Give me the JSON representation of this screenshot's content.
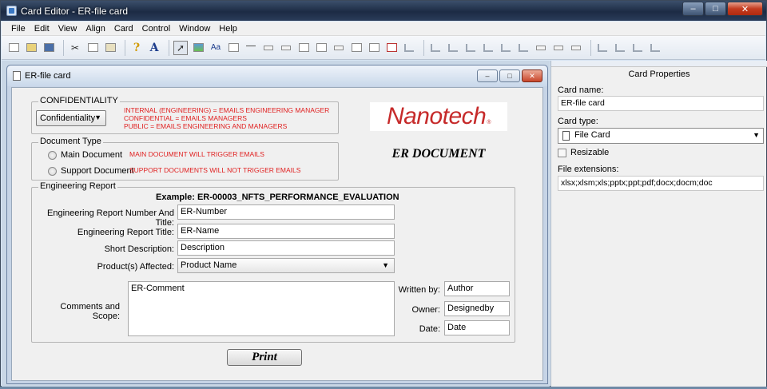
{
  "window": {
    "title": "Card Editor - ER-file card",
    "min_label": "–",
    "max_label": "□",
    "close_label": "✕"
  },
  "menu": [
    "File",
    "Edit",
    "View",
    "Align",
    "Card",
    "Control",
    "Window",
    "Help"
  ],
  "toolbar": {
    "icons": [
      "new-icon",
      "open-icon",
      "save-icon",
      "cut-icon",
      "copy-icon",
      "paste-icon",
      "help-icon",
      "font-icon",
      "pointer-icon",
      "image-icon",
      "text-icon",
      "label-icon",
      "line-icon",
      "button-icon",
      "radio-icon",
      "frame-icon",
      "checkbox-icon",
      "list-icon",
      "grid-icon",
      "combo-icon",
      "tab-icon",
      "align-left-icon",
      "align-right-icon",
      "align-top-icon",
      "align-bottom-icon",
      "distribute-icon",
      "size-icon"
    ],
    "help_glyph": "?",
    "font_glyph": "A",
    "text_glyph": "Aa"
  },
  "child_window": {
    "title": "ER-file card",
    "min_label": "–",
    "max_label": "□",
    "close_label": "✕"
  },
  "card": {
    "confidentiality": {
      "legend": "CONFIDENTIALITY",
      "selected": "Confidentiality",
      "note_lines": [
        "INTERNAL (ENGINEERING) = EMAILS ENGINEERING MANAGER",
        "CONFIDENTIAL = EMAILS MANAGERS",
        "PUBLIC = EMAILS ENGINEERING AND MANAGERS"
      ]
    },
    "document_type": {
      "legend": "Document Type",
      "main_label": "Main Document",
      "main_note": "MAIN DOCUMENT WILL TRIGGER EMAILS",
      "support_label": "Support Document",
      "support_note": "SUPPORT DOCUMENTS WILL NOT TRIGGER EMAILS"
    },
    "logo_text": "Nanotech",
    "logo_mark": "®",
    "heading": "ER DOCUMENT",
    "engineering_report": {
      "legend": "Engineering Report",
      "example": "Example:  ER-00003_NFTS_PERFORMANCE_EVALUATION",
      "number_label": "Engineering Report Number And Title:",
      "number_value": "ER-Number",
      "title_label": "Engineering Report Title:",
      "title_value": "ER-Name",
      "short_label": "Short Description:",
      "short_value": "Description",
      "product_label": "Product(s) Affected:",
      "product_value": "Product Name",
      "comments_label": "Comments and Scope:",
      "comments_value": "ER-Comment",
      "written_label": "Written by:",
      "written_value": "Author",
      "owner_label": "Owner:",
      "owner_value": "Designedby",
      "date_label": "Date:",
      "date_value": "Date"
    },
    "print_label": "Print"
  },
  "properties": {
    "title": "Card Properties",
    "card_name_label": "Card name:",
    "card_name_value": "ER-file card",
    "card_type_label": "Card type:",
    "card_type_value": "File Card",
    "resizable_label": "Resizable",
    "file_ext_label": "File extensions:",
    "file_ext_value": "xlsx;xlsm;xls;pptx;ppt;pdf;docx;docm;doc"
  }
}
